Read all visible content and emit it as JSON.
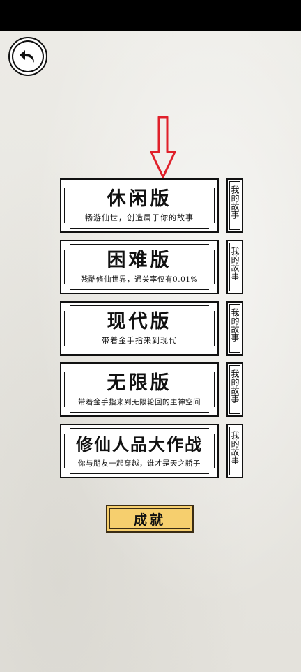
{
  "back": {
    "icon": "undo-arrow-icon"
  },
  "indicator": {
    "icon": "red-down-arrow-icon",
    "color": "#e0202a"
  },
  "modes": [
    {
      "title": "休闲版",
      "subtitle": "畅游仙世，创造属于你的故事",
      "story_label": "我的故事"
    },
    {
      "title": "困难版",
      "subtitle": "残酷修仙世界，通关率仅有0.01%",
      "story_label": "我的故事"
    },
    {
      "title": "现代版",
      "subtitle": "带着金手指来到现代",
      "story_label": "我的故事"
    },
    {
      "title": "无限版",
      "subtitle": "带着金手指来到无限轮回的主神空间",
      "story_label": "我的故事"
    },
    {
      "title": "修仙人品大作战",
      "subtitle": "你与朋友一起穿越，谁才是天之骄子",
      "story_label": "我的故事"
    }
  ],
  "achievement": {
    "label": "成就",
    "color": "#f6cf6e"
  }
}
